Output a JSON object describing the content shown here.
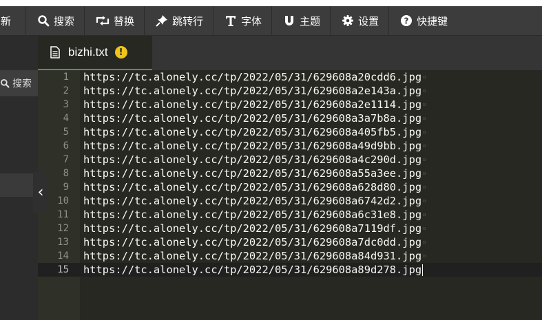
{
  "toolbar": {
    "items": [
      {
        "label": "刷新",
        "icon": "refresh-icon"
      },
      {
        "label": "搜索",
        "icon": "search-icon"
      },
      {
        "label": "替换",
        "icon": "replace-icon"
      },
      {
        "label": "跳转行",
        "icon": "pin-icon"
      },
      {
        "label": "字体",
        "icon": "font-icon"
      },
      {
        "label": "主题",
        "icon": "theme-icon"
      },
      {
        "label": "设置",
        "icon": "gear-icon"
      },
      {
        "label": "快捷键",
        "icon": "help-icon"
      }
    ]
  },
  "sidebar": {
    "search_label": "搜索",
    "collapse_glyph": "‹"
  },
  "tab": {
    "filename": "bizhi.txt",
    "warning_glyph": "!"
  },
  "editor": {
    "active_line": 15,
    "lines": [
      {
        "num": "1",
        "text": "https://tc.alonely.cc/tp/2022/05/31/629608a20cdd6.jpg"
      },
      {
        "num": "2",
        "text": "https://tc.alonely.cc/tp/2022/05/31/629608a2e143a.jpg"
      },
      {
        "num": "3",
        "text": "https://tc.alonely.cc/tp/2022/05/31/629608a2e1114.jpg"
      },
      {
        "num": "4",
        "text": "https://tc.alonely.cc/tp/2022/05/31/629608a3a7b8a.jpg"
      },
      {
        "num": "5",
        "text": "https://tc.alonely.cc/tp/2022/05/31/629608a405fb5.jpg"
      },
      {
        "num": "6",
        "text": "https://tc.alonely.cc/tp/2022/05/31/629608a49d9bb.jpg"
      },
      {
        "num": "7",
        "text": "https://tc.alonely.cc/tp/2022/05/31/629608a4c290d.jpg"
      },
      {
        "num": "8",
        "text": "https://tc.alonely.cc/tp/2022/05/31/629608a55a3ee.jpg"
      },
      {
        "num": "9",
        "text": "https://tc.alonely.cc/tp/2022/05/31/629608a628d80.jpg"
      },
      {
        "num": "10",
        "text": "https://tc.alonely.cc/tp/2022/05/31/629608a6742d2.jpg"
      },
      {
        "num": "11",
        "text": "https://tc.alonely.cc/tp/2022/05/31/629608a6c31e8.jpg"
      },
      {
        "num": "12",
        "text": "https://tc.alonely.cc/tp/2022/05/31/629608a7119df.jpg"
      },
      {
        "num": "13",
        "text": "https://tc.alonely.cc/tp/2022/05/31/629608a7dc0dd.jpg"
      },
      {
        "num": "14",
        "text": "https://tc.alonely.cc/tp/2022/05/31/629608a84d931.jpg"
      },
      {
        "num": "15",
        "text": "https://tc.alonely.cc/tp/2022/05/31/629608a89d278.jpg"
      }
    ]
  },
  "colors": {
    "editor_bg": "#272822",
    "gutter_bg": "#2f3129",
    "toolbar_bg": "#3c3c3c",
    "tab_active_border": "#39a83a",
    "warning": "#f0c419"
  }
}
